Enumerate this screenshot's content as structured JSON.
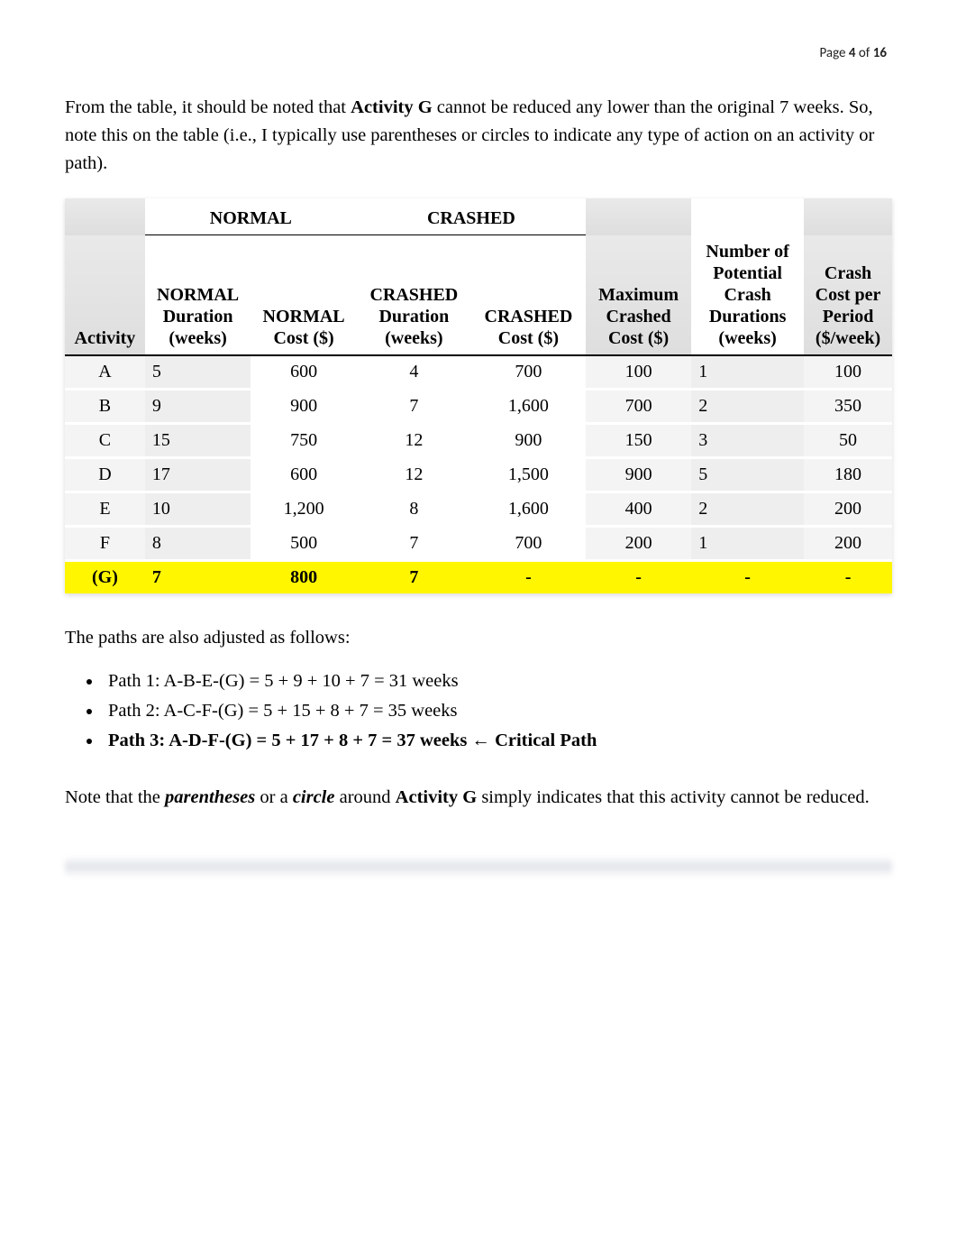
{
  "header": {
    "prefix": "Page ",
    "current": "4",
    "of": " of ",
    "total": "16"
  },
  "intro": {
    "before": "From the table, it should be noted that ",
    "bold": "Activity G",
    "after": " cannot be reduced any lower than the original 7 weeks.   So, note this on the table (i.e., I typically use parentheses or circles to indicate any type of action on an activity or path)."
  },
  "table": {
    "group1": "NORMAL",
    "group2": "CRASHED",
    "headers": {
      "activity": "Activity",
      "normal_duration": "NORMAL Duration (weeks)",
      "normal_cost": "NORMAL Cost ($)",
      "crashed_duration": "CRASHED Duration (weeks)",
      "crashed_cost": "CRASHED Cost ($)",
      "max_crashed": "Maximum Crashed Cost ($)",
      "potential": "Number of Potential Crash Durations (weeks)",
      "crash_cost_period": "Crash Cost per Period ($/week)"
    },
    "rows": [
      {
        "a": "A",
        "nd": "5",
        "nc": "600",
        "cd": "4",
        "cc": "700",
        "mc": "100",
        "pot": "1",
        "ccp": "100"
      },
      {
        "a": "B",
        "nd": "9",
        "nc": "900",
        "cd": "7",
        "cc": "1,600",
        "mc": "700",
        "pot": "2",
        "ccp": "350"
      },
      {
        "a": "C",
        "nd": "15",
        "nc": "750",
        "cd": "12",
        "cc": "900",
        "mc": "150",
        "pot": "3",
        "ccp": "50"
      },
      {
        "a": "D",
        "nd": "17",
        "nc": "600",
        "cd": "12",
        "cc": "1,500",
        "mc": "900",
        "pot": "5",
        "ccp": "180"
      },
      {
        "a": "E",
        "nd": "10",
        "nc": "1,200",
        "cd": "8",
        "cc": "1,600",
        "mc": "400",
        "pot": "2",
        "ccp": "200"
      },
      {
        "a": "F",
        "nd": "8",
        "nc": "500",
        "cd": "7",
        "cc": "700",
        "mc": "200",
        "pot": "1",
        "ccp": "200"
      },
      {
        "a": "(G)",
        "nd": "7",
        "nc": "800",
        "cd": "7",
        "cc": "-",
        "mc": "-",
        "pot": "-",
        "ccp": "-"
      }
    ]
  },
  "follow": "The paths are also adjusted as follows:",
  "paths": {
    "p1": "Path 1: A-B-E-(G) = 5 + 9 + 10 + 7 = 31 weeks",
    "p2": "Path 2: A-C-F-(G) = 5 + 15 + 8 + 7 = 35 weeks",
    "p3": "Path 3: A-D-F-(G) = 5 + 17 + 8 + 7 = 37 weeks ← Critical Path"
  },
  "note": {
    "t1": "Note that the ",
    "it1": "parentheses",
    "t2": " or a ",
    "it2": "circle",
    "t3": " around ",
    "b1": "Activity G",
    "t4": " simply indicates that this activity cannot be reduced."
  }
}
